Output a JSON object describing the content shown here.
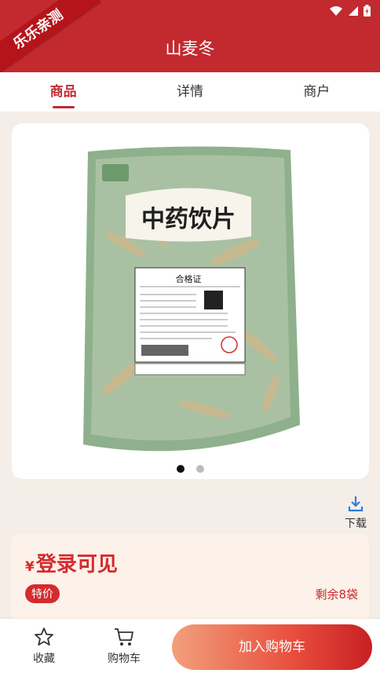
{
  "ribbon": "乐乐亲测",
  "title": "山麦冬",
  "tabs": [
    {
      "label": "商品",
      "active": true
    },
    {
      "label": "详情",
      "active": false
    },
    {
      "label": "商户",
      "active": false
    }
  ],
  "product": {
    "package_title": "中药饮片",
    "certificate": "合格证",
    "image_dots": 2,
    "active_dot": 1
  },
  "download_label": "下载",
  "price": {
    "symbol": "¥",
    "text": "登录可见"
  },
  "badge": "特价",
  "remaining": "剩余8袋",
  "bottom": {
    "favorite": "收藏",
    "cart": "购物车",
    "add_to_cart": "加入购物车"
  },
  "icons": [
    "wifi-icon",
    "signal-icon",
    "battery-icon",
    "download-icon",
    "star-icon",
    "cart-icon"
  ],
  "colors": {
    "brand": "#c22a2f",
    "price": "#d62a2f"
  }
}
